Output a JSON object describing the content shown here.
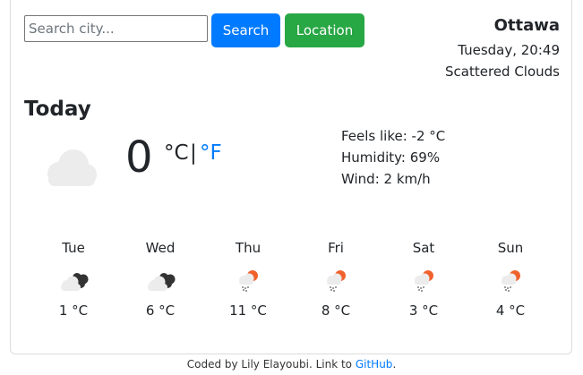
{
  "search": {
    "placeholder": "Search city..."
  },
  "buttons": {
    "search": "Search",
    "location": "Location"
  },
  "header": {
    "city": "Ottawa",
    "datetime": "Tuesday, 20:49",
    "description": "Scattered Clouds"
  },
  "today": {
    "title": "Today",
    "icon": "cloud-icon",
    "temperature": "0",
    "unit_c": "°C",
    "unit_separator": "|",
    "unit_f": "°F",
    "feels_like": "Feels like: -2 °C",
    "humidity": "Humidity: 69%",
    "wind": "Wind: 2 km/h"
  },
  "forecast": [
    {
      "day": "Tue",
      "icon": "night-cloudy-icon",
      "temp": "1 °C"
    },
    {
      "day": "Wed",
      "icon": "night-cloudy-icon",
      "temp": "6 °C"
    },
    {
      "day": "Thu",
      "icon": "sun-rain-icon",
      "temp": "11 °C"
    },
    {
      "day": "Fri",
      "icon": "sun-rain-icon",
      "temp": "8 °C"
    },
    {
      "day": "Sat",
      "icon": "sun-rain-icon",
      "temp": "3 °C"
    },
    {
      "day": "Sun",
      "icon": "sun-rain-icon",
      "temp": "4 °C"
    }
  ],
  "footer": {
    "text": "Coded by Lily Elayoubi. Link to ",
    "link": "GitHub",
    "end": "."
  },
  "colors": {
    "primary": "#007bff",
    "success": "#28a745",
    "sun": "#f0622d",
    "cloud": "#ececec"
  }
}
